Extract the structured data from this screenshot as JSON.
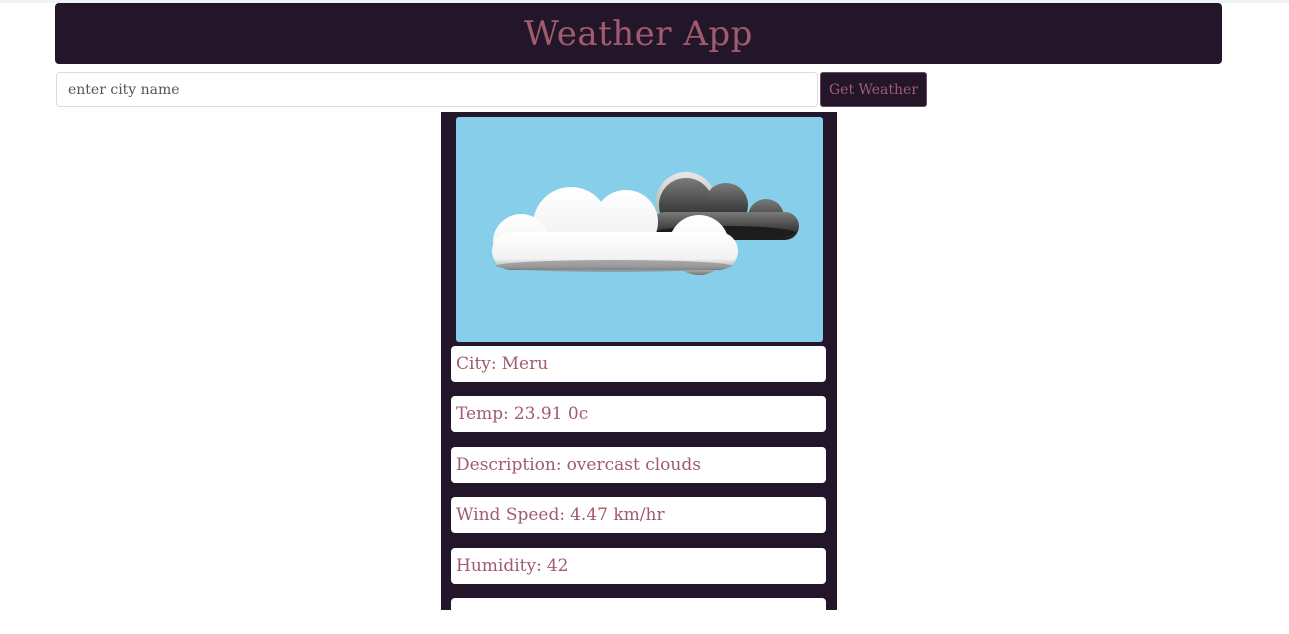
{
  "app": {
    "title": "Weather App"
  },
  "search": {
    "placeholder": "enter city name",
    "value": "",
    "button_label": "Get Weather"
  },
  "weather": {
    "icon": "cloudy-weather-icon",
    "city_label": "City:",
    "city": "Meru",
    "temp_label": "Temp:",
    "temp": "23.91 0c",
    "description_label": "Description:",
    "description": "overcast clouds",
    "wind_label": "Wind Speed:",
    "wind": "4.47 km/hr",
    "humidity_label": "Humidity:",
    "humidity": "42"
  },
  "colors": {
    "primary_dark": "#23162b",
    "accent": "#a05c6c",
    "sky": "#87ceeb"
  }
}
